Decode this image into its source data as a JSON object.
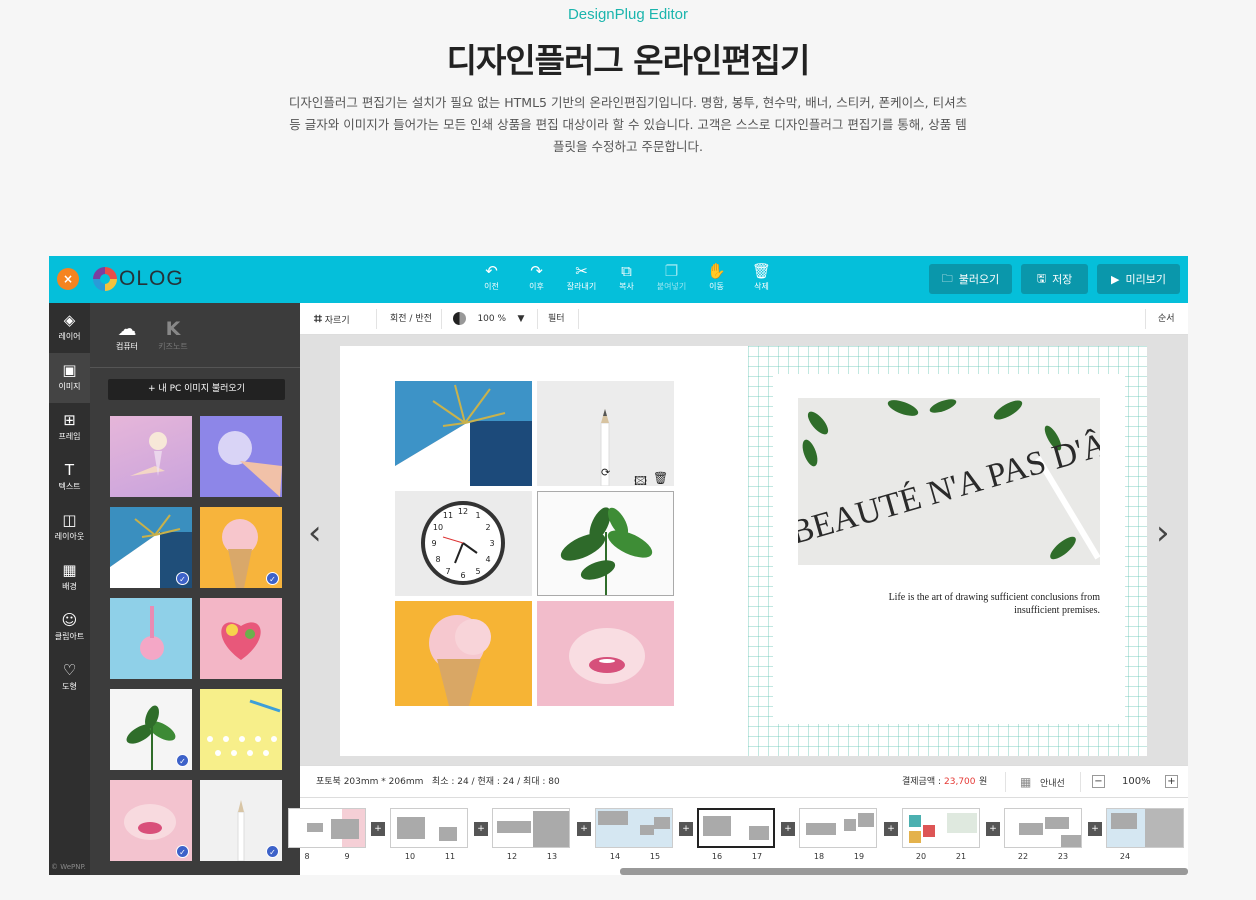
{
  "hero": {
    "subtitle": "DesignPlug Editor",
    "title": "디자인플러그 온라인편집기",
    "description": "디자인플러그 편집기는 설치가 필요 없는 HTML5 기반의 온라인편집기입니다. 명함, 봉투, 현수막, 배너, 스티커, 폰케이스, 티셔츠 등 글자와 이미지가 들어가는 모든 인쇄 상품을 편집 대상이라 할 수 있습니다. 고객은 스스로 디자인플러그 편집기를 통해, 상품 템플릿을 수정하고 주문합니다."
  },
  "topbar": {
    "close": "×",
    "logo": "OLOG",
    "tools": [
      {
        "label": "이전",
        "icon": "↶"
      },
      {
        "label": "이후",
        "icon": "↷"
      },
      {
        "label": "잘라내기",
        "icon": "✂"
      },
      {
        "label": "복사",
        "icon": "⧉"
      },
      {
        "label": "붙여넣기",
        "icon": "❐"
      },
      {
        "label": "이동",
        "icon": "✋"
      },
      {
        "label": "삭제",
        "icon": "🗑"
      }
    ],
    "load": "불러오기",
    "save": "저장",
    "preview": "미리보기"
  },
  "sidebar": {
    "items": [
      {
        "label": "레이어",
        "icon": "◈"
      },
      {
        "label": "이미지",
        "icon": "▣"
      },
      {
        "label": "프레임",
        "icon": "⊞"
      },
      {
        "label": "텍스트",
        "icon": "T"
      },
      {
        "label": "레이아웃",
        "icon": "◫"
      },
      {
        "label": "배경",
        "icon": "▦"
      },
      {
        "label": "클립아트",
        "icon": "☺"
      },
      {
        "label": "도형",
        "icon": "♡"
      }
    ],
    "footer": "© WePNP."
  },
  "panel": {
    "tab_computer": "컴퓨터",
    "tab_keynote": "키즈노트",
    "upload": "+ 내 PC 이미지 불러오기"
  },
  "subbar": {
    "crop": "자르기",
    "rotate": "회전 / 반전",
    "opacity": "100 %",
    "filter": "필터",
    "order": "순서"
  },
  "page_right": {
    "photo_text": "LA BEAUTÉ N'A PAS D'ÂGE",
    "quote": "Life is the art of drawing sufficient conclusions from insufficient premises."
  },
  "infobar": {
    "spec": "포토북 203mm * 206mm   최소 : 24 / 현재 : 24 / 최대 : 80",
    "price_label": "결제금액 :",
    "price_value": "23,700",
    "price_unit": "원",
    "guide": "안내선",
    "zoom": "100%"
  },
  "pages": [
    "8",
    "9",
    "10",
    "11",
    "12",
    "13",
    "14",
    "15",
    "16",
    "17",
    "18",
    "19",
    "20",
    "21",
    "22",
    "23",
    "24"
  ],
  "colors": {
    "topbar": "#05bfda",
    "button": "#0a97ab",
    "accent": "#1bb5ad",
    "price": "#e53935"
  }
}
